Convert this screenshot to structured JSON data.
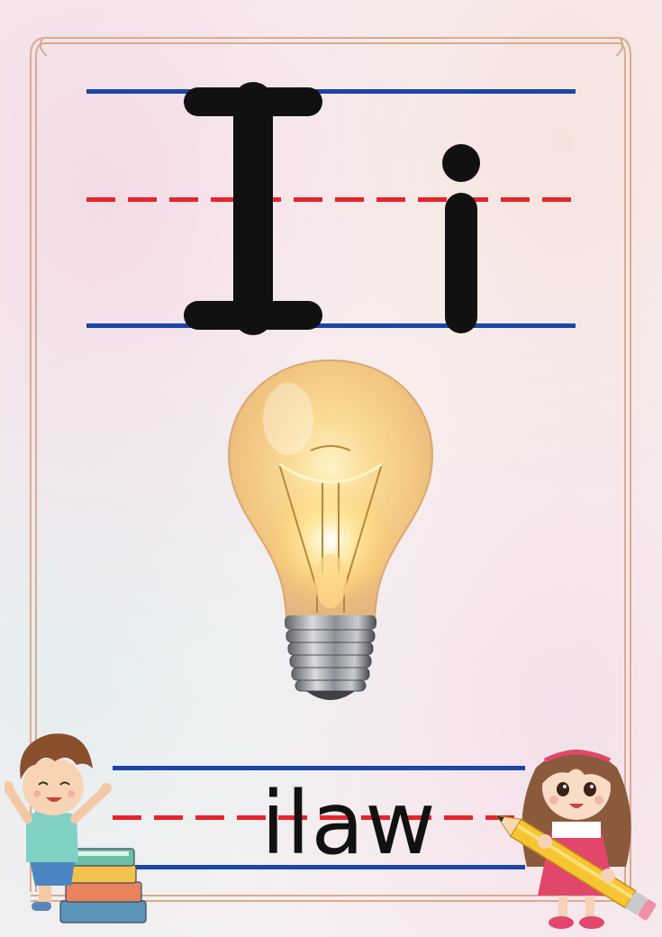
{
  "letters": {
    "uppercase": "I",
    "lowercase": "i"
  },
  "word": "ilaw",
  "picture": "light-bulb",
  "colors": {
    "guide_blue": "#1a46a8",
    "guide_red": "#e8232a",
    "letter": "#111111",
    "frame": "#d9ab8f"
  }
}
